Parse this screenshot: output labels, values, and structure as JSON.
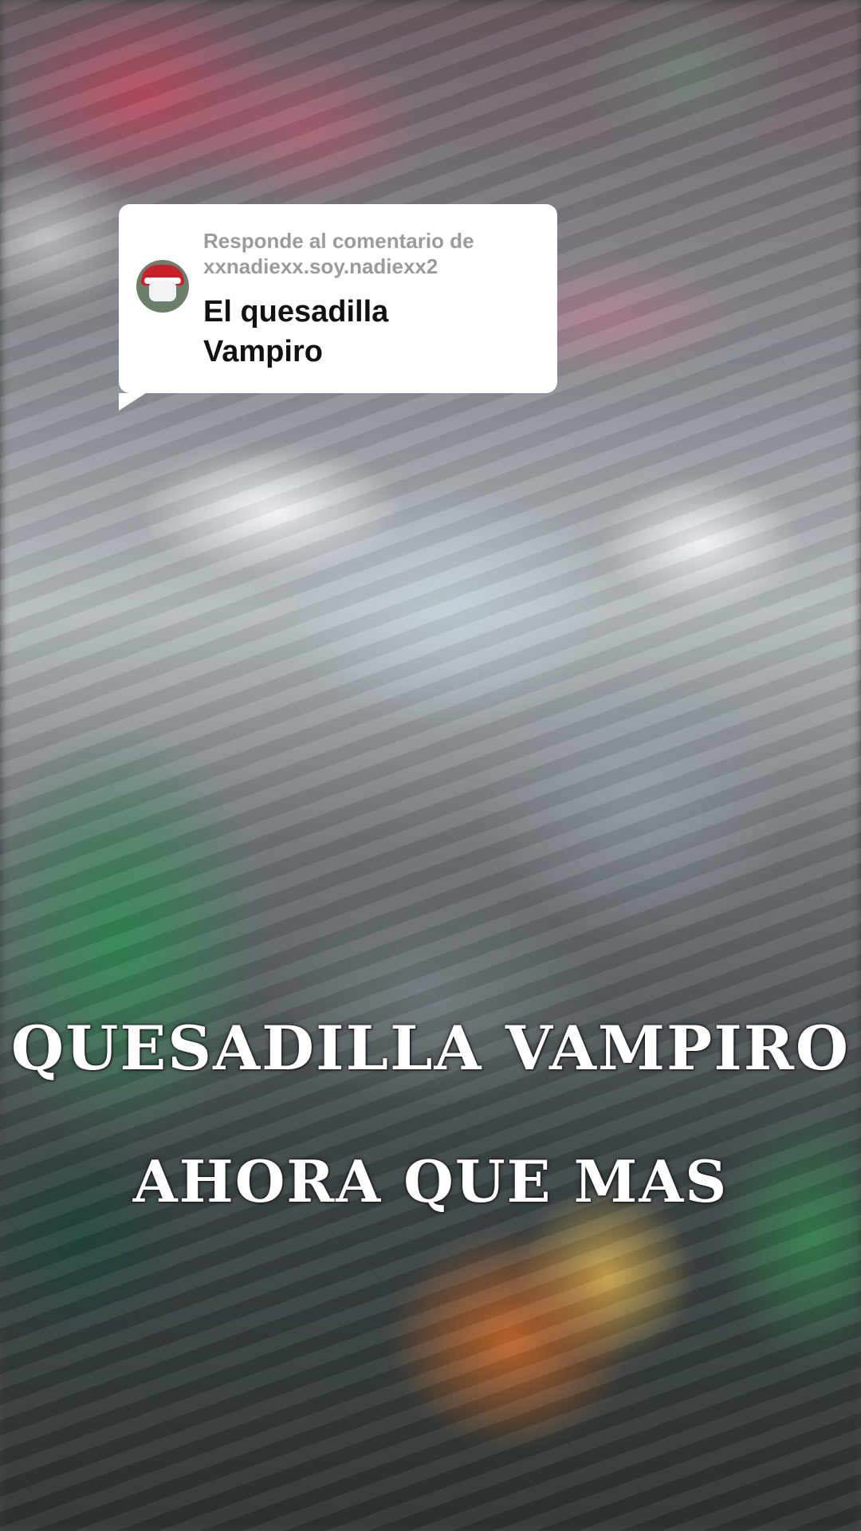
{
  "reply_sticker": {
    "header_line_1": "Responde al comentario de",
    "header_line_2": "xxnadiexx.soy.nadiexx2",
    "comment_line_1": "El quesadilla",
    "comment_line_2": "Vampiro"
  },
  "overlay_text": {
    "line_1": "QUESADILLA VAMPIRO",
    "line_2": "AHORA QUE MAS"
  }
}
